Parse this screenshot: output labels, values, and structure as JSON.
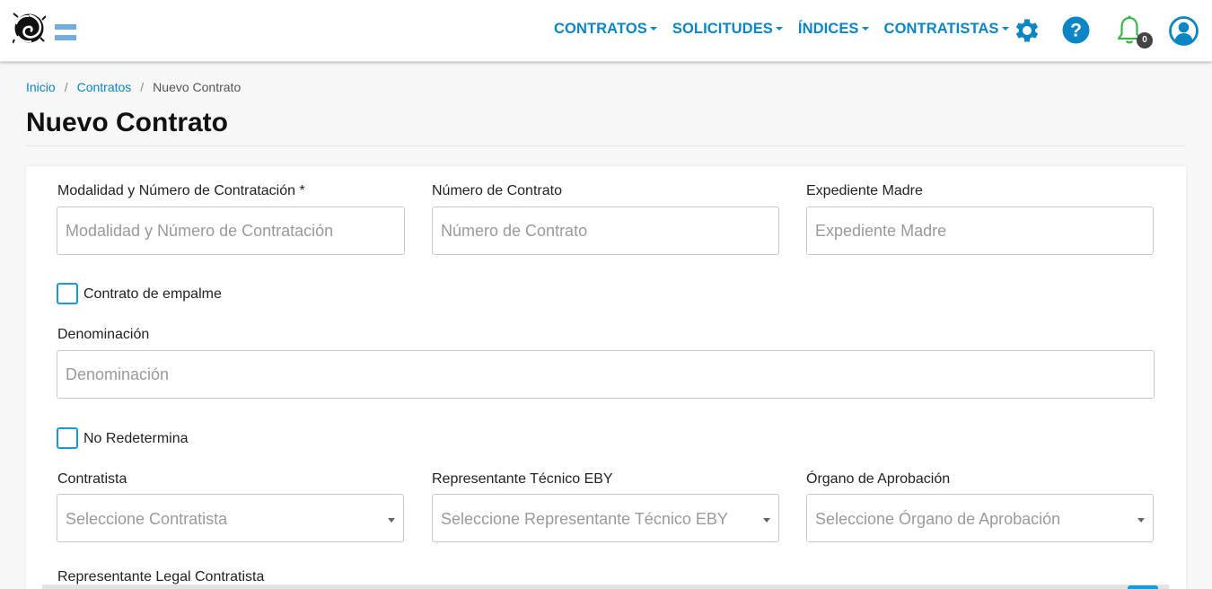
{
  "header": {
    "menu": [
      {
        "label": "CONTRATOS"
      },
      {
        "label": "SOLICITUDES"
      },
      {
        "label": "ÍNDICES"
      },
      {
        "label": "CONTRATISTAS"
      }
    ],
    "notifications_count": "0",
    "icons": [
      "logo-icon",
      "argentina-flag-icon",
      "gear-icon",
      "help-icon",
      "bell-icon",
      "user-icon"
    ],
    "accent_color": "#0b85c3"
  },
  "breadcrumb": {
    "home": "Inicio",
    "section": "Contratos",
    "current": "Nuevo Contrato",
    "separator": "/"
  },
  "page": {
    "title": "Nuevo Contrato"
  },
  "form": {
    "modalidad": {
      "label": "Modalidad y Número de Contratación *",
      "placeholder": "Modalidad y Número de Contratación",
      "value": ""
    },
    "numero_contrato": {
      "label": "Número de Contrato",
      "placeholder": "Número de Contrato",
      "value": ""
    },
    "expediente": {
      "label": "Expediente Madre",
      "placeholder": "Expediente Madre",
      "value": ""
    },
    "empalme": {
      "label": "Contrato de empalme",
      "checked": false
    },
    "denominacion": {
      "label": "Denominación",
      "placeholder": "Denominación",
      "value": ""
    },
    "no_redetermina": {
      "label": "No Redetermina",
      "checked": false
    },
    "contratista": {
      "label": "Contratista",
      "placeholder": "Seleccione Contratista"
    },
    "representante": {
      "label": "Representante Técnico EBY",
      "placeholder": "Seleccione Representante Técnico EBY"
    },
    "organo": {
      "label": "Órgano de Aprobación",
      "placeholder": "Seleccione Órgano de Aprobación"
    },
    "representante_legal": {
      "label": "Representante Legal Contratista"
    }
  }
}
